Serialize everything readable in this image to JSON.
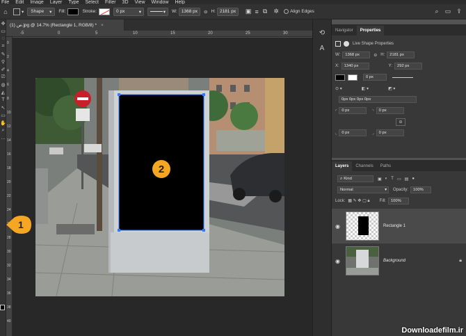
{
  "menubar": {
    "items": [
      "File",
      "Edit",
      "Image",
      "Layer",
      "Type",
      "Select",
      "Filter",
      "3D",
      "View",
      "Window",
      "Help"
    ]
  },
  "options": {
    "mode": "Shape",
    "fill_label": "Fill:",
    "stroke_label": "Stroke:",
    "stroke_width": "0 px",
    "w_label": "W:",
    "w_value": "1368 px",
    "link_icon": "link-icon",
    "h_label": "H:",
    "h_value": "2181 px",
    "align_edges": "Align Edges"
  },
  "document": {
    "tab_title": "ص (1).jpg @ 14.7% (Rectangle 1, RGB/8) *",
    "close": "×"
  },
  "ruler": {
    "top_ticks": [
      "-5",
      "0",
      "5",
      "10",
      "15",
      "20",
      "25",
      "30"
    ],
    "left_ticks": [
      "0",
      "2",
      "4",
      "6",
      "8",
      "10",
      "12",
      "14",
      "16",
      "18",
      "20",
      "22",
      "24",
      "26",
      "28",
      "30",
      "32",
      "34",
      "36",
      "38",
      "40"
    ]
  },
  "properties": {
    "tabs": [
      "Navigator",
      "Properties"
    ],
    "section": "Live Shape Properties",
    "w_label": "W:",
    "w_value": "1368 px",
    "h_label": "H:",
    "h_value": "2181 px",
    "x_label": "X:",
    "x_value": "1340 px",
    "y_label": "Y:",
    "y_value": "292 px",
    "stroke_width": "0 px",
    "corners_all": "0px 0px 0px 0px",
    "corner_tl": "0 px",
    "corner_tr": "0 px",
    "corner_bl": "0 px",
    "corner_br": "0 px"
  },
  "layers": {
    "tabs": [
      "Layers",
      "Channels",
      "Paths"
    ],
    "filter": "Kind",
    "blend_mode": "Normal",
    "opacity_label": "Opacity:",
    "opacity_value": "100%",
    "lock_label": "Lock:",
    "fill_label": "Fill:",
    "fill_value": "100%",
    "items": [
      {
        "name": "Rectangle 1",
        "selected": true
      },
      {
        "name": "Background",
        "selected": false
      }
    ]
  },
  "annotations": {
    "marker_1": "1",
    "marker_2": "2"
  },
  "watermark": "Downloadefilm.ir",
  "colors": {
    "accent_marker": "#f5a623",
    "selection_blue": "#2f7bff"
  }
}
